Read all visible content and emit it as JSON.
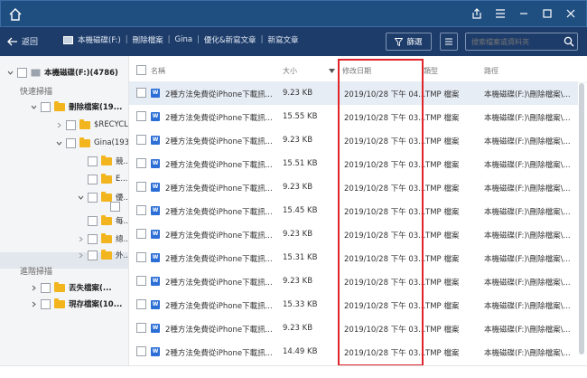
{
  "titlebar": {
    "home_icon": "home-icon",
    "controls": [
      "share-icon",
      "menu-icon",
      "minimize-icon",
      "maximize-icon",
      "close-icon"
    ]
  },
  "nav": {
    "back_label": "返回",
    "breadcrumb": [
      "本機磁碟(F:)",
      "刪除檔案",
      "Gina",
      "優化&新寫文章",
      "新寫文章"
    ],
    "filter_label": "篩選",
    "search_placeholder": "搜索檔案或資料夾"
  },
  "sidebar": {
    "drive_label": "本機磁碟(F:)(4786)",
    "quick_scan": "快速掃描",
    "deleted_files": "刪除檔案(19...",
    "recycle": "$RECYCL...",
    "gina": "Gina(1935)",
    "f1": "競...",
    "f2": "E...",
    "f3": "優...",
    "f4": "每...",
    "f5": "總...",
    "f6": "外...",
    "deep_scan": "進階掃描",
    "lost_files": "丟失檔案(...",
    "existing_files": "現存檔案(10..."
  },
  "columns": {
    "name": "名稱",
    "size": "大小",
    "modified": "修改日期",
    "type": "類型",
    "path": "路徑"
  },
  "rows": [
    {
      "name": "2種方法免費從iPhone下載訊...",
      "size": "9.23 KB",
      "date": "2019/10/28 下午 04...",
      "type": "TMP 檔案",
      "path": "本機磁碟(F:)\\刪除檔案\\..."
    },
    {
      "name": "2種方法免費從iPhone下載訊...",
      "size": "15.55 KB",
      "date": "2019/10/28 下午 03...",
      "type": "TMP 檔案",
      "path": "本機磁碟(F:)\\刪除檔案\\..."
    },
    {
      "name": "2種方法免費從iPhone下載訊...",
      "size": "9.23 KB",
      "date": "2019/10/28 下午 03...",
      "type": "TMP 檔案",
      "path": "本機磁碟(F:)\\刪除檔案\\..."
    },
    {
      "name": "2種方法免費從iPhone下載訊...",
      "size": "15.51 KB",
      "date": "2019/10/28 下午 03...",
      "type": "TMP 檔案",
      "path": "本機磁碟(F:)\\刪除檔案\\..."
    },
    {
      "name": "2種方法免費從iPhone下載訊...",
      "size": "9.23 KB",
      "date": "2019/10/28 下午 03...",
      "type": "TMP 檔案",
      "path": "本機磁碟(F:)\\刪除檔案\\..."
    },
    {
      "name": "2種方法免費從iPhone下載訊...",
      "size": "15.45 KB",
      "date": "2019/10/28 下午 03...",
      "type": "TMP 檔案",
      "path": "本機磁碟(F:)\\刪除檔案\\..."
    },
    {
      "name": "2種方法免費從iPhone下載訊...",
      "size": "9.23 KB",
      "date": "2019/10/28 下午 03...",
      "type": "TMP 檔案",
      "path": "本機磁碟(F:)\\刪除檔案\\..."
    },
    {
      "name": "2種方法免費從iPhone下載訊...",
      "size": "15.31 KB",
      "date": "2019/10/28 下午 03...",
      "type": "TMP 檔案",
      "path": "本機磁碟(F:)\\刪除檔案\\..."
    },
    {
      "name": "2種方法免費從iPhone下載訊...",
      "size": "9.23 KB",
      "date": "2019/10/28 下午 03...",
      "type": "TMP 檔案",
      "path": "本機磁碟(F:)\\刪除檔案\\..."
    },
    {
      "name": "2種方法免費從iPhone下載訊...",
      "size": "15.33 KB",
      "date": "2019/10/28 下午 03...",
      "type": "TMP 檔案",
      "path": "本機磁碟(F:)\\刪除檔案\\..."
    },
    {
      "name": "2種方法免費從iPhone下載訊...",
      "size": "9.23 KB",
      "date": "2019/10/28 下午 03...",
      "type": "TMP 檔案",
      "path": "本機磁碟(F:)\\刪除檔案\\..."
    },
    {
      "name": "2種方法免費從iPhone下載訊...",
      "size": "14.49 KB",
      "date": "2019/10/28 下午 03...",
      "type": "TMP 檔案",
      "path": "本機磁碟(F:)\\刪除檔案\\..."
    }
  ],
  "colors": {
    "titlebar": "#1f4e80",
    "navbar": "#1e3c6a",
    "accent": "#2b6ed6",
    "folder": "#f3b51d",
    "highlight": "#e0242b"
  }
}
